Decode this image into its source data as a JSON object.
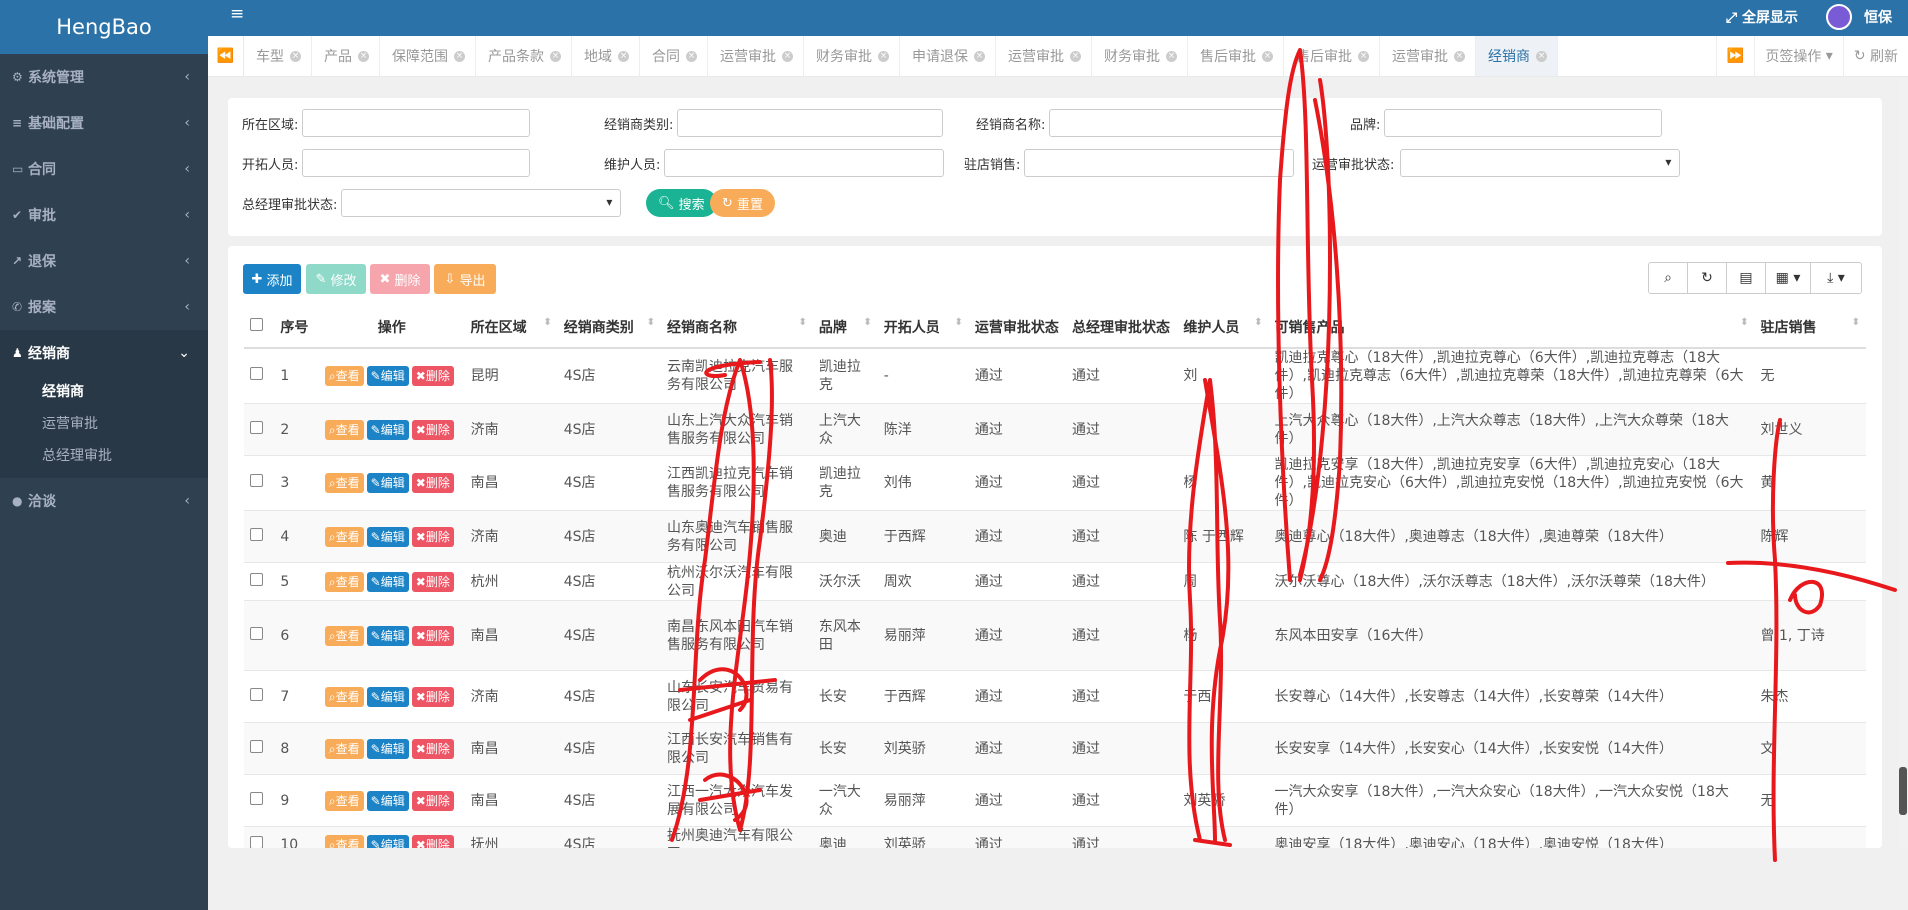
{
  "app": {
    "brand": "HengBao"
  },
  "sidebar": {
    "items": [
      {
        "label": "系统管理",
        "icon": "gear-icon",
        "icon_glyph": "⚙"
      },
      {
        "label": "基础配置",
        "icon": "database-icon",
        "icon_glyph": "≡"
      },
      {
        "label": "合同",
        "icon": "folder-icon",
        "icon_glyph": "▭"
      },
      {
        "label": "审批",
        "icon": "check-icon",
        "icon_glyph": "✔"
      },
      {
        "label": "退保",
        "icon": "share-icon",
        "icon_glyph": "↗"
      },
      {
        "label": "报案",
        "icon": "phone-icon",
        "icon_glyph": "✆"
      },
      {
        "label": "经销商",
        "icon": "user-icon",
        "icon_glyph": "♟"
      },
      {
        "label": "洽谈",
        "icon": "chat-icon",
        "icon_glyph": "●"
      }
    ],
    "submenu": [
      "经销商",
      "运营审批",
      "总经理审批"
    ]
  },
  "header": {
    "fullscreen": "全屏显示",
    "user": "恒保",
    "menu_icon": "≡"
  },
  "tabs": {
    "items": [
      "车型",
      "产品",
      "保障范围",
      "产品条款",
      "地域",
      "合同",
      "运营审批",
      "财务审批",
      "申请退保",
      "运营审批",
      "财务审批",
      "售后审批",
      "售后审批",
      "运营审批",
      "经销商"
    ],
    "page_ops": "页签操作",
    "refresh": "刷新"
  },
  "search": {
    "region_label": "所在区域:",
    "dealer_type_label": "经销商类别:",
    "dealer_name_label": "经销商名称:",
    "brand_label": "品牌:",
    "developer_label": "开拓人员:",
    "maintainer_label": "维护人员:",
    "store_sales_label": "驻店销售:",
    "ops_status_label": "运营审批状态:",
    "gm_status_label": "总经理审批状态:",
    "search_btn": "搜索",
    "reset_btn": "重置"
  },
  "toolbar": {
    "add": "添加",
    "edit": "修改",
    "delete": "删除",
    "export": "导出"
  },
  "table": {
    "headers": [
      "序号",
      "操作",
      "所在区域",
      "经销商类别",
      "经销商名称",
      "品牌",
      "开拓人员",
      "运营审批状态",
      "总经理审批状态",
      "维护人员",
      "可销售产品",
      "驻店销售"
    ],
    "action_labels": {
      "view": "查看",
      "edit": "编辑",
      "delete": "删除"
    },
    "rows": [
      {
        "no": "1",
        "region": "昆明",
        "type": "4S店",
        "name": "云南凯迪拉克汽车服务有限公司",
        "brand": "凯迪拉克",
        "developer": "-",
        "ops": "通过",
        "gm": "通过",
        "maintainer": "刘",
        "products": "凯迪拉克尊心（18大件）,凯迪拉克尊心（6大件）,凯迪拉克尊志（18大件）,凯迪拉克尊志（6大件）,凯迪拉克尊荣（18大件）,凯迪拉克尊荣（6大件）",
        "sales": "无"
      },
      {
        "no": "2",
        "region": "济南",
        "type": "4S店",
        "name": "山东上汽大众汽车销售服务有限公司",
        "brand": "上汽大众",
        "developer": "陈洋",
        "ops": "通过",
        "gm": "通过",
        "maintainer": "",
        "products": "上汽大众尊心（18大件）,上汽大众尊志（18大件）,上汽大众尊荣（18大件）",
        "sales": "刘世义"
      },
      {
        "no": "3",
        "region": "南昌",
        "type": "4S店",
        "name": "江西凯迪拉克汽车销售服务有限公司",
        "brand": "凯迪拉克",
        "developer": "刘伟",
        "ops": "通过",
        "gm": "通过",
        "maintainer": "杨",
        "products": "凯迪拉克安享（18大件）,凯迪拉克安享（6大件）,凯迪拉克安心（18大件）,凯迪拉克安心（6大件）,凯迪拉克安悦（18大件）,凯迪拉克安悦（6大件）",
        "sales": "黄"
      },
      {
        "no": "4",
        "region": "济南",
        "type": "4S店",
        "name": "山东奥迪汽车销售服务有限公司",
        "brand": "奥迪",
        "developer": "于西辉",
        "ops": "通过",
        "gm": "通过",
        "maintainer": "陈 于西辉",
        "products": "奥迪尊心（18大件）,奥迪尊志（18大件）,奥迪尊荣（18大件）",
        "sales": "陈辉"
      },
      {
        "no": "5",
        "region": "杭州",
        "type": "4S店",
        "name": "杭州沃尔沃汽车有限公司",
        "brand": "沃尔沃",
        "developer": "周欢",
        "ops": "通过",
        "gm": "通过",
        "maintainer": "周",
        "products": "沃尔沃尊心（18大件）,沃尔沃尊志（18大件）,沃尔沃尊荣（18大件）",
        "sales": ""
      },
      {
        "no": "6",
        "region": "南昌",
        "type": "4S店",
        "name": "南昌东风本田汽车销售服务有限公司",
        "brand": "东风本田",
        "developer": "易丽萍",
        "ops": "通过",
        "gm": "通过",
        "maintainer": "杨",
        "products": "东风本田安享（16大件）",
        "sales": "曾 1, 丁诗"
      },
      {
        "no": "7",
        "region": "济南",
        "type": "4S店",
        "name": "山东长安汽车贸易有限公司",
        "brand": "长安",
        "developer": "于西辉",
        "ops": "通过",
        "gm": "通过",
        "maintainer": "于西",
        "products": "长安尊心（14大件）,长安尊志（14大件）,长安尊荣（14大件）",
        "sales": "朱杰"
      },
      {
        "no": "8",
        "region": "南昌",
        "type": "4S店",
        "name": "江西长安汽车销售有限公司",
        "brand": "长安",
        "developer": "刘英骄",
        "ops": "通过",
        "gm": "通过",
        "maintainer": "",
        "products": "长安安享（14大件）,长安安心（14大件）,长安安悦（14大件）",
        "sales": "文"
      },
      {
        "no": "9",
        "region": "南昌",
        "type": "4S店",
        "name": "江西一汽大众汽车发展有限公司",
        "brand": "一汽大众",
        "developer": "易丽萍",
        "ops": "通过",
        "gm": "通过",
        "maintainer": "刘英骄",
        "products": "一汽大众安享（18大件）,一汽大众安心（18大件）,一汽大众安悦（18大件）",
        "sales": "无"
      },
      {
        "no": "10",
        "region": "抚州",
        "type": "4S店",
        "name": "抚州奥迪汽车有限公司",
        "brand": "奥迪",
        "developer": "刘英骄",
        "ops": "通过",
        "gm": "通过",
        "maintainer": "",
        "products": "奥迪安享（18大件）,奥迪安心（18大件）,奥迪安悦（18大件）",
        "sales": ""
      }
    ]
  },
  "colors": {
    "brand_blue": "#2b72a8",
    "sidebar_bg": "#2f4050",
    "primary": "#1c84c6",
    "success": "#1ab394",
    "warning": "#f8ac59",
    "danger": "#ed5565",
    "scribble": "#e8191c"
  }
}
